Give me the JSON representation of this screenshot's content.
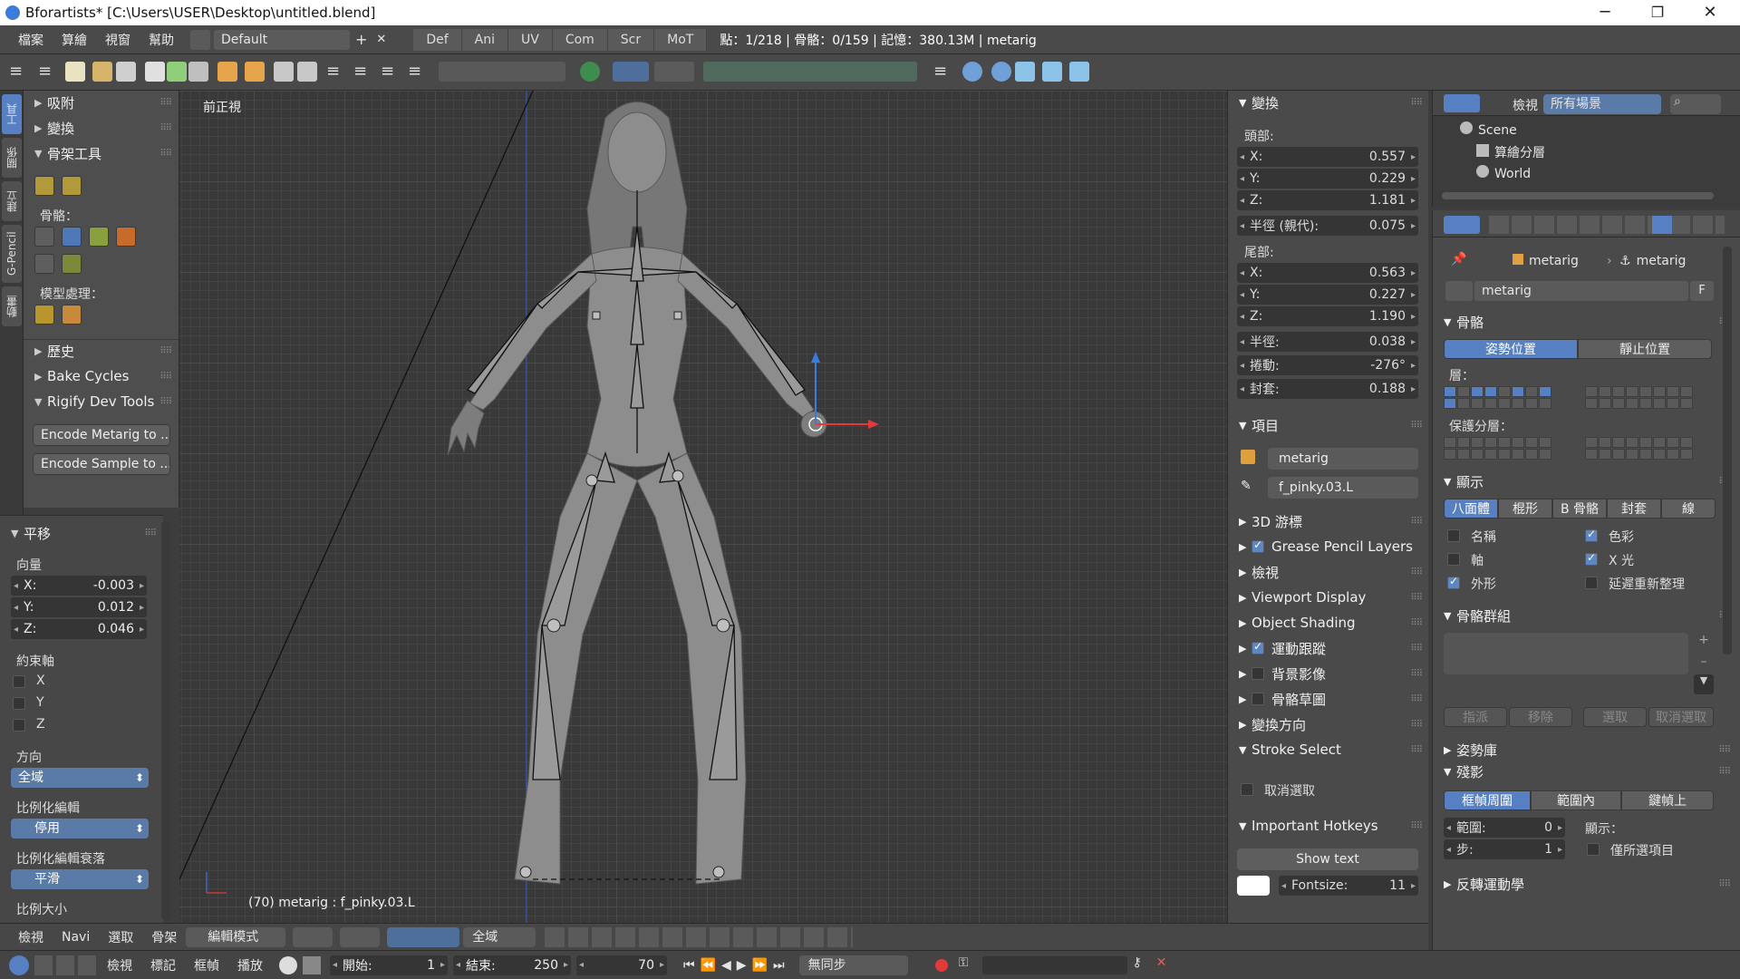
{
  "window": {
    "title": "Bforartists* [C:\\Users\\USER\\Desktop\\untitled.blend]",
    "minimize": "─",
    "maximize": "❐",
    "close": "✕"
  },
  "menu": [
    "檔案",
    "算繪",
    "視窗",
    "幫助"
  ],
  "layout": {
    "name": "Default",
    "add": "+",
    "remove": "✕"
  },
  "workspaces": [
    "Def",
    "Ani",
    "UV",
    "Com",
    "Scr",
    "MoT"
  ],
  "stats": "點：1/218 | 骨骼：0/159 | 記憶：380.13M | metarig",
  "lefttabs": [
    "工具",
    "關係",
    "建立",
    "G-Pencil",
    "動畫"
  ],
  "toolshelf": {
    "snap": "吸附",
    "transform": "變換",
    "armature_tools": "骨架工具",
    "bones_label": "骨骼：",
    "modeling_label": "模型處理：",
    "history": "歷史",
    "bake_cycles": "Bake Cycles",
    "rigify": "Rigify Dev Tools",
    "encode_metarig": "Encode Metarig to ...",
    "encode_sample": "Encode Sample to ..."
  },
  "redo": {
    "title": "平移",
    "vector": "向量",
    "x": {
      "label": "X:",
      "value": "-0.003"
    },
    "y": {
      "label": "Y:",
      "value": "0.012"
    },
    "z": {
      "label": "Z:",
      "value": "0.046"
    },
    "constraint": "約束軸",
    "cx": "X",
    "cy": "Y",
    "cz": "Z",
    "orientation": "方向",
    "orientation_val": "全域",
    "prop_edit": "比例化編輯",
    "prop_edit_val": "停用",
    "falloff": "比例化編輯衰落",
    "falloff_val": "平滑",
    "prop_size": "比例大小"
  },
  "viewport": {
    "label": "前正視",
    "status": "(70) metarig : f_pinky.03.L"
  },
  "npanel": {
    "transform": "變換",
    "head": "頭部:",
    "head_x": {
      "label": "X:",
      "value": "0.557"
    },
    "head_y": {
      "label": "Y:",
      "value": "0.229"
    },
    "head_z": {
      "label": "Z:",
      "value": "1.181"
    },
    "radius_parent": {
      "label": "半徑 (親代):",
      "value": "0.075"
    },
    "tail": "尾部:",
    "tail_x": {
      "label": "X:",
      "value": "0.563"
    },
    "tail_y": {
      "label": "Y:",
      "value": "0.227"
    },
    "tail_z": {
      "label": "Z:",
      "value": "1.190"
    },
    "radius": {
      "label": "半徑:",
      "value": "0.038"
    },
    "roll": {
      "label": "捲動:",
      "value": "-276°"
    },
    "envelope": {
      "label": "封套:",
      "value": "0.188"
    },
    "item": "項目",
    "item_object": "metarig",
    "item_bone": "f_pinky.03.L",
    "cursor": "3D 游標",
    "gp_layers": "Grease Pencil Layers",
    "view": "檢視",
    "viewport_display": "Viewport Display",
    "object_shading": "Object Shading",
    "motion_tracking": "運動跟蹤",
    "bg_images": "背景影像",
    "bone_sketch": "骨骼草圖",
    "transform_orient": "變換方向",
    "stroke_select": "Stroke Select",
    "deselect": "取消選取",
    "hotkeys": "Important Hotkeys",
    "show_text": "Show text",
    "fontsize": {
      "label": "Fontsize:",
      "value": "11"
    }
  },
  "outliner": {
    "view": "檢視",
    "filter": "所有場景",
    "scene": "Scene",
    "render_layers": "算繪分層",
    "world": "World"
  },
  "props": {
    "breadcrumb1": "metarig",
    "breadcrumb2": "metarig",
    "datablock": "metarig",
    "fake_user": "F",
    "skeleton": "骨骼",
    "pose_position": "姿勢位置",
    "rest_position": "靜止位置",
    "layers": "層：",
    "protected_layers": "保護分層：",
    "display": "顯示",
    "disp_modes": [
      "八面體",
      "棍形",
      "B 骨骼",
      "封套",
      "線"
    ],
    "names": "名稱",
    "colors": "色彩",
    "axes": "軸",
    "xray": "X 光",
    "shapes": "外形",
    "delay_refresh": "延遲重新整理",
    "bone_groups": "骨骼群組",
    "assign": "指派",
    "remove": "移除",
    "select": "選取",
    "deselect": "取消選取",
    "pose_library": "姿勢庫",
    "ghost": "殘影",
    "ghost_modes": [
      "框幀周圍",
      "範圍內",
      "鍵幀上"
    ],
    "range": {
      "label": "範圍:",
      "value": "0"
    },
    "step": {
      "label": "步:",
      "value": "1"
    },
    "display_lbl": "顯示：",
    "selected_only": "僅所選項目",
    "ik": "反轉運動學"
  },
  "vphdr": {
    "view": "檢視",
    "navi": "Navi",
    "select": "選取",
    "armature": "骨架",
    "mode": "編輯模式",
    "orient": "全域"
  },
  "timeline": {
    "view": "檢視",
    "marker": "標記",
    "frame": "框幀",
    "playback": "播放",
    "start": {
      "label": "開始:",
      "value": "1"
    },
    "end": {
      "label": "結束:",
      "value": "250"
    },
    "current": "70",
    "sync": "無同步"
  },
  "colors": {
    "accent": "#5680c2",
    "x_axis": "#e03a3a",
    "y_axis": "#3a7be0",
    "mesh": "#8c8c8c"
  }
}
